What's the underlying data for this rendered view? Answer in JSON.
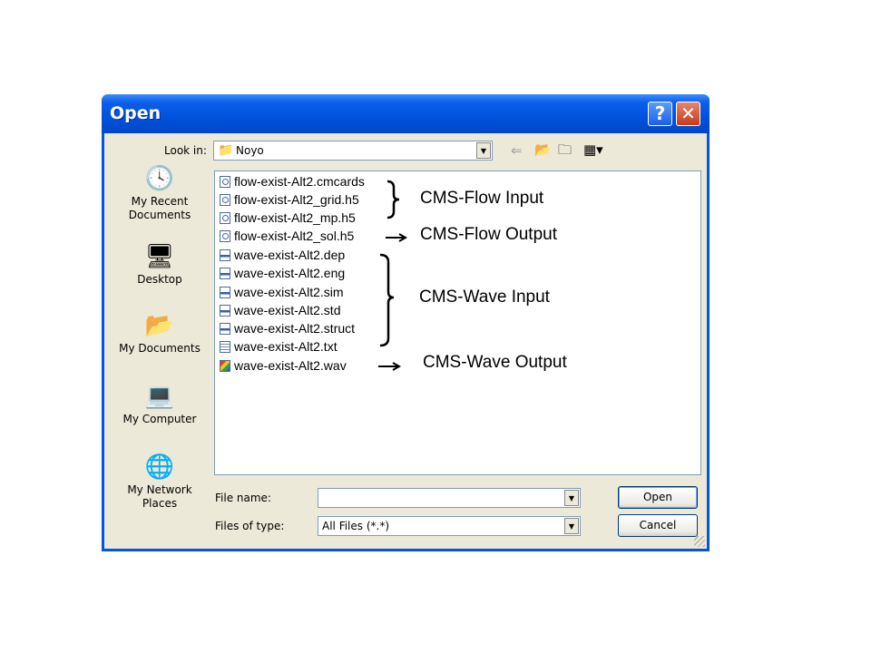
{
  "dialog": {
    "title": "Open",
    "help_label": "?",
    "close_label": "✕"
  },
  "lookin": {
    "label": "Look in:",
    "folder": "Noyo"
  },
  "places": [
    {
      "label": "My Recent Documents",
      "icon": "recent-documents-icon"
    },
    {
      "label": "Desktop",
      "icon": "desktop-icon"
    },
    {
      "label": "My Documents",
      "icon": "my-documents-icon"
    },
    {
      "label": "My Computer",
      "icon": "my-computer-icon"
    },
    {
      "label": "My Network Places",
      "icon": "network-places-icon"
    }
  ],
  "files": [
    {
      "name": "flow-exist-Alt2.cmcards",
      "type": "h5"
    },
    {
      "name": "flow-exist-Alt2_grid.h5",
      "type": "h5"
    },
    {
      "name": "flow-exist-Alt2_mp.h5",
      "type": "h5"
    },
    {
      "name": "flow-exist-Alt2_sol.h5",
      "type": "h5"
    },
    {
      "name": "wave-exist-Alt2.dep",
      "type": "dat"
    },
    {
      "name": "wave-exist-Alt2.eng",
      "type": "dat"
    },
    {
      "name": "wave-exist-Alt2.sim",
      "type": "dat"
    },
    {
      "name": "wave-exist-Alt2.std",
      "type": "dat"
    },
    {
      "name": "wave-exist-Alt2.struct",
      "type": "dat"
    },
    {
      "name": "wave-exist-Alt2.txt",
      "type": "txt"
    },
    {
      "name": "wave-exist-Alt2.wav",
      "type": "wav"
    }
  ],
  "annotations": {
    "flow_input": "CMS-Flow Input",
    "flow_output": "CMS-Flow Output",
    "wave_input": "CMS-Wave Input",
    "wave_output": "CMS-Wave Output"
  },
  "filename": {
    "label": "File name:",
    "value": ""
  },
  "filetype": {
    "label": "Files of type:",
    "value": "All Files (*.*)"
  },
  "buttons": {
    "open": "Open",
    "cancel": "Cancel"
  },
  "colors": {
    "title_bar": "#0055e5",
    "dialog_face": "#ece9d8"
  }
}
